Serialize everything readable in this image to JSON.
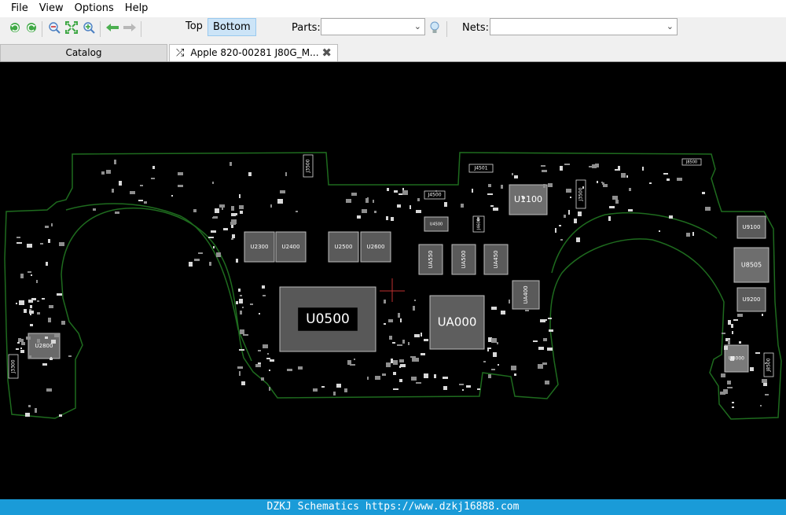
{
  "menu": {
    "items": [
      "File",
      "View",
      "Options",
      "Help"
    ]
  },
  "toolbar": {
    "icons": [
      "rotate-left-icon",
      "rotate-right-icon",
      "zoom-out-icon",
      "fit-view-icon",
      "zoom-in-icon",
      "back-arrow-icon",
      "forward-arrow-icon"
    ],
    "side_top": "Top",
    "side_bottom": "Bottom",
    "parts_label": "Parts:",
    "parts_value": "",
    "nets_label": "Nets:",
    "nets_value": ""
  },
  "tabs": {
    "catalog": "Catalog",
    "board": "Apple 820-00281 J80G_M..."
  },
  "board": {
    "components": [
      "U0500",
      "UA000",
      "U1100",
      "U2300",
      "U2400",
      "U2500",
      "U2600",
      "UA550",
      "UA500",
      "UA450",
      "UA400",
      "U2800",
      "U9100",
      "U8505",
      "U9200",
      "UB000",
      "J4501",
      "J4500",
      "J4600",
      "J3500",
      "J3500",
      "J3300",
      "J8500",
      "J8500",
      "U4500"
    ],
    "outline_color": "#1e6b1e"
  },
  "footer": {
    "text": "DZKJ Schematics https://www.dzkj16888.com"
  }
}
